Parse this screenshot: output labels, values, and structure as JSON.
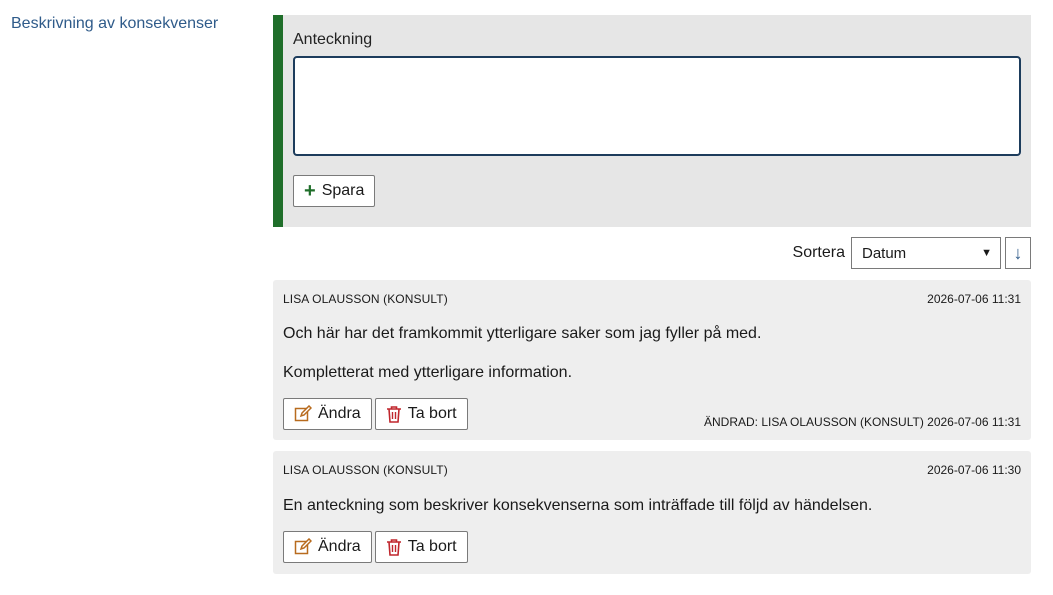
{
  "field": {
    "label": "Beskrivning av konsekvenser"
  },
  "editor": {
    "label": "Anteckning",
    "value": "",
    "save_label": "Spara",
    "colors": {
      "accent": "#1f6e2a"
    }
  },
  "sort": {
    "label": "Sortera",
    "selected": "Datum",
    "direction_icon": "arrow-down-icon"
  },
  "notes": [
    {
      "author": "LISA OLAUSSON (KONSULT)",
      "timestamp": "2026-07-06 11:31",
      "paragraphs": [
        "Och här har det framkommit ytterligare saker som jag fyller på med.",
        "Kompletterat med ytterligare information."
      ],
      "edit_label": "Ändra",
      "delete_label": "Ta bort",
      "modified": "ÄNDRAD: LISA OLAUSSON (KONSULT) 2026-07-06 11:31"
    },
    {
      "author": "LISA OLAUSSON (KONSULT)",
      "timestamp": "2026-07-06 11:30",
      "paragraphs": [
        "En anteckning som beskriver konsekvenserna som inträffade till följd av händelsen."
      ],
      "edit_label": "Ändra",
      "delete_label": "Ta bort"
    }
  ],
  "icons": {
    "edit_color": "#b86b1e",
    "delete_color": "#c0262d"
  }
}
